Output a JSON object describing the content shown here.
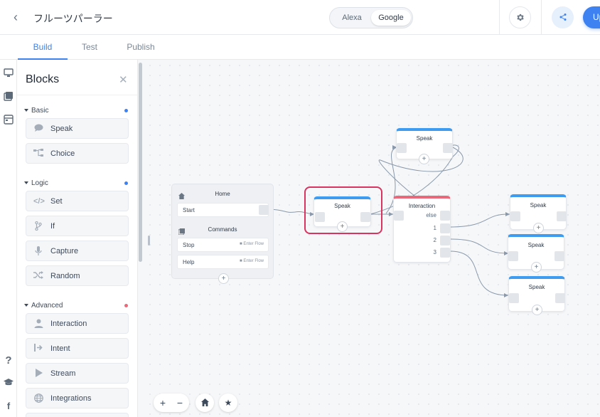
{
  "header": {
    "title": "フルーツパーラー",
    "platforms": {
      "alexa": "Alexa",
      "google": "Google",
      "selected": "Google"
    },
    "upload_label": "Up"
  },
  "tabs": [
    {
      "label": "Build",
      "active": true
    },
    {
      "label": "Test",
      "active": false
    },
    {
      "label": "Publish",
      "active": false
    }
  ],
  "rail": {
    "top_icons": [
      "monitor-icon",
      "library-icon",
      "panel-icon"
    ],
    "bottom_icons": [
      "help-icon",
      "graduation-cap-icon",
      "facebook-icon"
    ]
  },
  "panel": {
    "title": "Blocks",
    "sections": [
      {
        "name": "Basic",
        "dot_color": "#3d82f0",
        "items": [
          {
            "label": "Speak",
            "icon": "speech-bubble-icon"
          },
          {
            "label": "Choice",
            "icon": "choice-icon"
          }
        ]
      },
      {
        "name": "Logic",
        "dot_color": "#3d82f0",
        "items": [
          {
            "label": "Set",
            "icon": "code-icon"
          },
          {
            "label": "If",
            "icon": "branch-icon"
          },
          {
            "label": "Capture",
            "icon": "microphone-icon"
          },
          {
            "label": "Random",
            "icon": "shuffle-icon"
          }
        ]
      },
      {
        "name": "Advanced",
        "dot_color": "#e9697a",
        "items": [
          {
            "label": "Interaction",
            "icon": "user-icon"
          },
          {
            "label": "Intent",
            "icon": "intent-icon"
          },
          {
            "label": "Stream",
            "icon": "play-icon"
          },
          {
            "label": "Integrations",
            "icon": "globe-icon"
          }
        ]
      }
    ]
  },
  "canvas": {
    "home_node": {
      "title": "Home",
      "start_label": "Start",
      "commands_title": "Commands",
      "commands": [
        {
          "label": "Stop",
          "flow": "Enter Flow"
        },
        {
          "label": "Help",
          "flow": "Enter Flow"
        }
      ]
    },
    "speak_selected": {
      "title": "Speak"
    },
    "speak_top": {
      "title": "Speak"
    },
    "interaction": {
      "title": "Interaction",
      "ports": [
        "else",
        "1",
        "2",
        "3"
      ]
    },
    "speak_right": [
      {
        "title": "Speak"
      },
      {
        "title": "Speak"
      },
      {
        "title": "Speak"
      }
    ]
  },
  "colors": {
    "accent": "#3d82f0",
    "speak_top": "#3d9bf0",
    "interaction_top": "#e9697a",
    "selection": "#d8345f"
  }
}
